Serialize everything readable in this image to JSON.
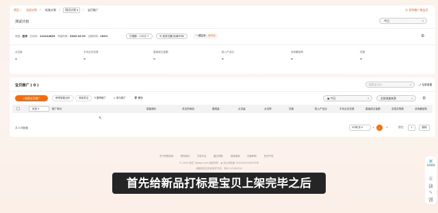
{
  "breadcrumb": {
    "items": [
      "首页",
      "全部计划",
      "标准计划",
      "测试计划"
    ],
    "current": "宝贝推广",
    "right_link": "☺ 如何推广新宝贝"
  },
  "plan": {
    "title": "测试计划",
    "date_select": "今日",
    "info": {
      "status_label": "状态：",
      "status_value": "暂停",
      "id_label": "计划ID：",
      "id_value": "112414625",
      "start_label": "开始时间：",
      "start_value": "2020-10-29",
      "budget_label": "当前时间：",
      "budget_value": "100%",
      "daily_budget": "日限额：100元",
      "placement": "投放位置/地域/时间",
      "optimize_label": "一键监测：",
      "optimize_value": "未开启"
    },
    "metrics": [
      {
        "label": "点击量",
        "value": "-"
      },
      {
        "label": "平均点击花费",
        "value": "-"
      },
      {
        "label": "直接成交金额",
        "value": "-"
      },
      {
        "label": "投入产出比",
        "value": "-"
      },
      {
        "label": "总收藏加购",
        "value": "-"
      },
      {
        "label": "花费",
        "value": "-"
      }
    ]
  },
  "promo": {
    "title": "宝贝推广 ( 0 )",
    "search_placeholder": "搜索宝贝ID",
    "fullscreen": "全屏查看",
    "new_button": "+新建宝贝推广",
    "tools": [
      "修改智能出价",
      "添加关注",
      "暂停推广",
      "参与推广",
      "删除"
    ],
    "date_select": "今日",
    "filter_select": "全部流量来源",
    "status_filter": "状态",
    "columns": [
      "推广单元",
      "智能调价",
      "关注的商品",
      "展现量",
      "点击量",
      "点击率",
      "花费",
      "投入产出比",
      "平均点击花费",
      "直接成交金额",
      "总成交笔数",
      "总收藏加购"
    ],
    "count": "共 0 项数据",
    "page_size": "20条/页",
    "prev": "<",
    "page": "1",
    "next": ">",
    "goto_label": "前往",
    "goto_value": "1",
    "jump": "跳转"
  },
  "site_footer": {
    "links": [
      "关于阿里妈妈",
      "联系我们",
      "开放平台",
      "廉正举报",
      "使用条款",
      "法律声明",
      "知识产权"
    ],
    "copyright": "© 2003-现在 Taobao.com 版权所有",
    "icp": "浙公网安备 33010002000078号",
    "license": "增值电信业务经营许可证：浙B2-20080224"
  },
  "subtitle": "首先给新品打标是宝贝上架完毕之后",
  "side_toolbar": {
    "items": [
      "在线客服",
      "平台\n指导",
      "问题\n反馈"
    ]
  },
  "colors": {
    "accent": "#ff6a00",
    "crumb": "#e9581d",
    "background": "#fbf2ec"
  }
}
